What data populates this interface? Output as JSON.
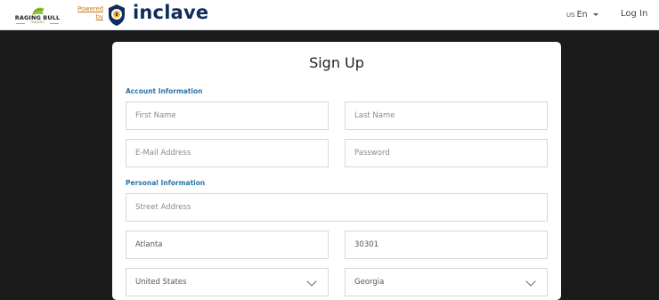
{
  "brand": {
    "partner_name": "RAGING BULL",
    "partner_tagline": "TRADING",
    "powered_line1": "Powered",
    "powered_line2": "by",
    "product_name": "inclave",
    "brand_color": "#0f2d5c",
    "accent_color": "#c7781b"
  },
  "nav": {
    "language_country": "US",
    "language": "En",
    "login_label": "Log In"
  },
  "form": {
    "title": "Sign Up",
    "section_account": "Account Information",
    "section_personal": "Personal Information",
    "first_name_placeholder": "First Name",
    "last_name_placeholder": "Last Name",
    "email_placeholder": "E-Mail Address",
    "password_placeholder": "Password",
    "street_placeholder": "Street Address",
    "city_value": "Atlanta",
    "zip_value": "30301",
    "country_value": "United States",
    "state_value": "Georgia"
  }
}
